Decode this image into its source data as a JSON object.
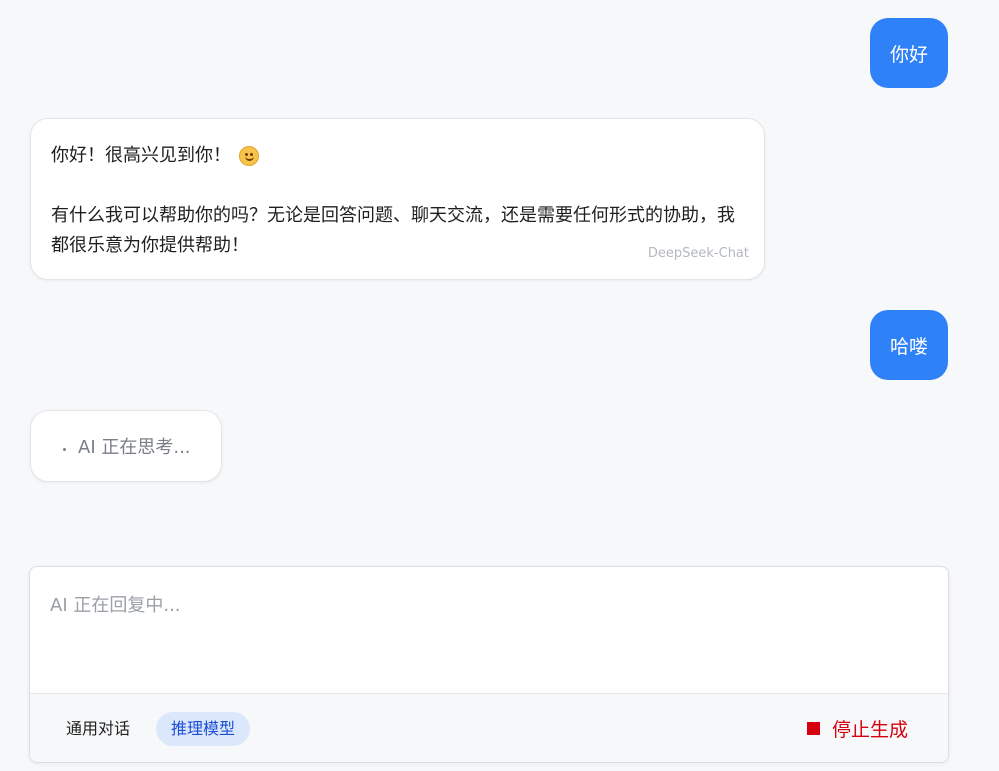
{
  "messages": {
    "user_1": "你好",
    "ai_1_line_1": "你好！很高兴见到你！",
    "ai_1_emoji": "smiling-face-icon",
    "ai_1_para": "有什么我可以帮助你的吗？无论是回答问题、聊天交流，还是需要任何形式的协助，我都很乐意为你提供帮助！",
    "ai_1_model": "DeepSeek-Chat",
    "user_2": "哈喽",
    "thinking": "AI 正在思考..."
  },
  "composer": {
    "placeholder": "AI 正在回复中...",
    "modes": [
      "通用对话",
      "推理模型"
    ],
    "active_mode": "推理模型",
    "stop_label": "停止生成"
  },
  "colors": {
    "user_bubble": "#2f81f7",
    "active_mode_bg": "#dbe8fb",
    "stop": "#d7000f",
    "background": "#f7f8fa"
  }
}
